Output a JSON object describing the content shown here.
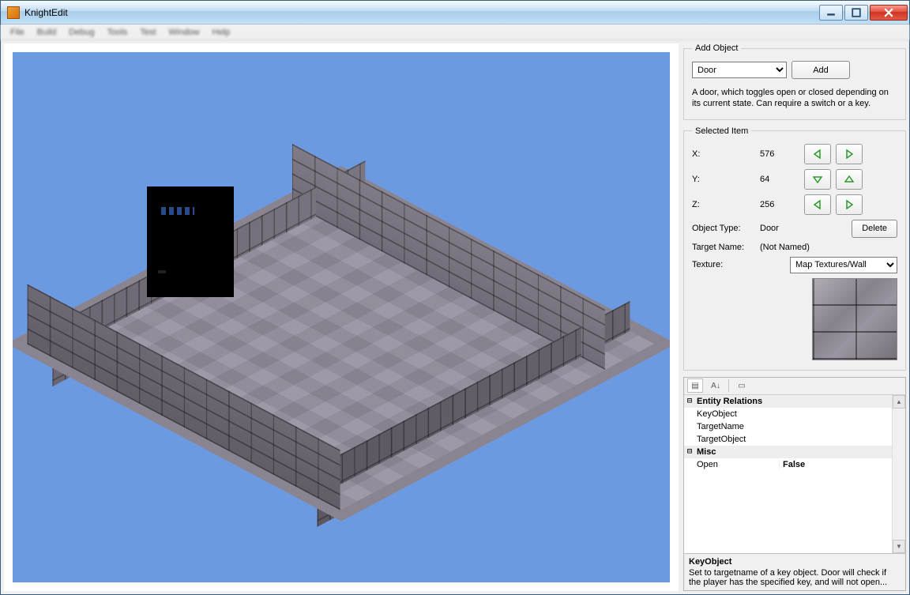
{
  "window": {
    "title": "KnightEdit"
  },
  "menubar": {
    "items": [
      "File",
      "Build",
      "Debug",
      "Tools",
      "Test",
      "Window",
      "Help"
    ]
  },
  "addObject": {
    "legend": "Add Object",
    "selected": "Door",
    "addLabel": "Add",
    "description": "A door, which toggles open or closed depending on its current state. Can require a switch or a key."
  },
  "selectedItem": {
    "legend": "Selected Item",
    "xLabel": "X:",
    "yLabel": "Y:",
    "zLabel": "Z:",
    "x": "576",
    "y": "64",
    "z": "256",
    "objectTypeLabel": "Object Type:",
    "objectType": "Door",
    "deleteLabel": "Delete",
    "targetNameLabel": "Target Name:",
    "targetName": "(Not Named)",
    "textureLabel": "Texture:",
    "texture": "Map Textures/Wall"
  },
  "propertyGrid": {
    "categories": [
      {
        "name": "Entity Relations",
        "props": [
          {
            "key": "KeyObject",
            "value": ""
          },
          {
            "key": "TargetName",
            "value": ""
          },
          {
            "key": "TargetObject",
            "value": ""
          }
        ]
      },
      {
        "name": "Misc",
        "props": [
          {
            "key": "Open",
            "value": "False",
            "dropdown": true
          }
        ]
      }
    ],
    "help": {
      "title": "KeyObject",
      "text": "Set to targetname of a key object. Door will check if the player has the specified key, and will not open..."
    }
  }
}
